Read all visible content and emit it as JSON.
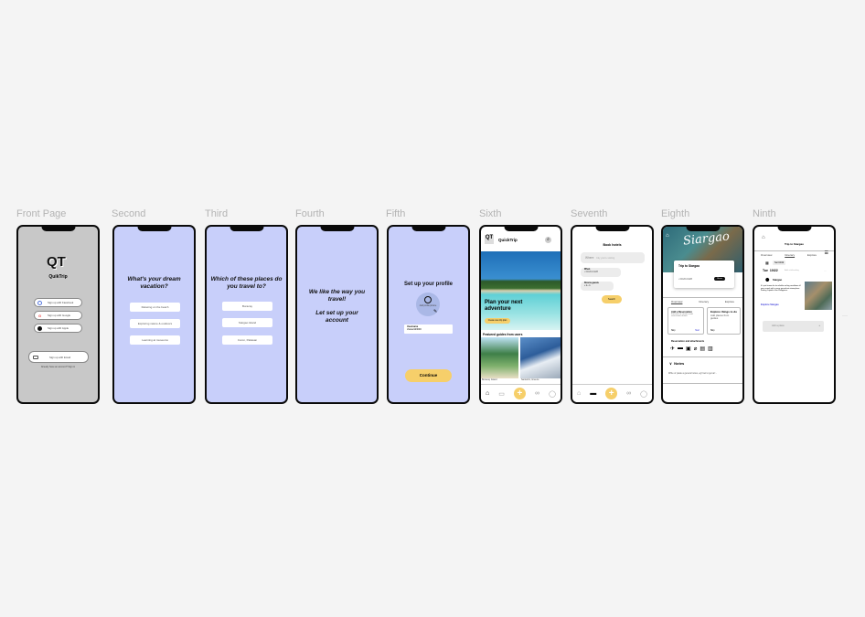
{
  "frames": {
    "labels": [
      "Front Page",
      "Second",
      "Third",
      "Fourth",
      "Fifth",
      "Sixth",
      "Seventh",
      "Eighth",
      "Ninth"
    ]
  },
  "front": {
    "logo": "QT",
    "brand": "QuikTrip",
    "facebook": "Sign up with Facebook",
    "google": "Sign up with Google",
    "apple": "Sign up with Apple",
    "email": "Sign up with Email",
    "signin": "Already have an account? Sign in"
  },
  "second": {
    "question": "What's your dream vacation?",
    "options": [
      "Relaxing on the beach",
      "Exploring nature & outdoors",
      "Learning at museums"
    ]
  },
  "third": {
    "question": "Which of these places do you travel to?",
    "options": [
      "Boracay",
      "Siargao Island",
      "Coron, Palawan"
    ]
  },
  "fourth": {
    "line1": "We like the way you travel!",
    "line2": "Let set up your account"
  },
  "fifth": {
    "title": "Set up your profile",
    "avatar_caption": "Add profile picture",
    "username_label": "Username",
    "username_value": "chanel123000",
    "continue": "Continue"
  },
  "sixth": {
    "logo": "QT",
    "brand": "QuickTrip",
    "hero_title": "Plan your next adventure",
    "hero_button": "Create new trip plan",
    "guides_title": "Featured guides from users",
    "guides": [
      "Boracay Island",
      "Santorini, Greece"
    ]
  },
  "seventh": {
    "title": "Book hotels",
    "where_label": "Where",
    "where_placeholder": "City you're visiting",
    "when_label": "When",
    "when_value": "04/20-04/28",
    "rooms_label": "Rooms guests",
    "rooms": "1",
    "guests": "1",
    "search": "Search"
  },
  "eighth": {
    "hero": "Siargao",
    "trip": "Trip to Siargao",
    "dates": "04/20-04/28",
    "share": "Share",
    "tabs": [
      "Overview",
      "Itinerary",
      "Explore"
    ],
    "card1_title": "Add a Reservation",
    "card1_text": "Forward an email or add reservation details",
    "card2_title": "Explore things to do",
    "card2_text": "Add places from guides",
    "skip": "Skip",
    "start": "Start",
    "res_title": "Reservation and attachments",
    "notes": "Notes",
    "notes_placeholder": "Write or paste a general notes, eg how to get arr..."
  },
  "ninth": {
    "title": "Trip to Siargao",
    "tabs": [
      "Overview",
      "Itinerary",
      "Explore"
    ],
    "date_chip": "Sat 04/22",
    "day": "Tue",
    "date": "10/22",
    "subheading": "Add subheading",
    "place": "Siargao",
    "description": "It's just known for its reliable surfing conditions all year round, with a more spread-out atmosphere. Surfing Capital of the Philippines.",
    "link": "Explore Siargao",
    "add_place": "Add a place"
  },
  "colors": {
    "lavender": "#c8cffa",
    "yellow": "#f6cf6a",
    "canvas": "#f4f4f4",
    "link": "#3b3bd9"
  }
}
